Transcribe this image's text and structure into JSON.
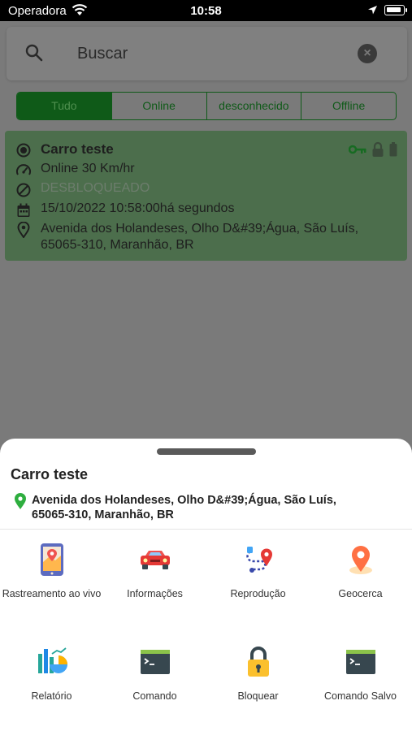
{
  "status_bar": {
    "carrier": "Operadora",
    "time": "10:58"
  },
  "search": {
    "placeholder": "Buscar"
  },
  "filters": [
    "Tudo",
    "Online",
    "desconhecido",
    "Offline"
  ],
  "active_filter": "Tudo",
  "vehicle": {
    "name": "Carro teste",
    "speed": "Online 30 Km/hr",
    "lock_status": "DESBLOQUEADO",
    "datetime": "15/10/2022 10:58:00há segundos",
    "address": "Avenida dos Holandeses, Olho D&#39;Água, São Luís, 65065-310, Maranhão, BR"
  },
  "sheet": {
    "title": "Carro teste",
    "address": "Avenida dos Holandeses, Olho D&#39;Água, São Luís, 65065-310, Maranhão, BR",
    "actions": [
      {
        "label": "Rastreamento ao vivo",
        "icon": "live-tracking-icon"
      },
      {
        "label": "Informações",
        "icon": "car-icon"
      },
      {
        "label": "Reprodução",
        "icon": "route-icon"
      },
      {
        "label": "Geocerca",
        "icon": "geofence-pin-icon"
      },
      {
        "label": "Relatório",
        "icon": "report-chart-icon"
      },
      {
        "label": "Comando",
        "icon": "terminal-icon"
      },
      {
        "label": "Bloquear",
        "icon": "padlock-icon"
      },
      {
        "label": "Comando Salvo",
        "icon": "terminal-icon"
      }
    ]
  },
  "colors": {
    "primary_green": "#1f8c2f",
    "card_green": "#4c6e4c",
    "pin_green": "#2eae3f"
  }
}
